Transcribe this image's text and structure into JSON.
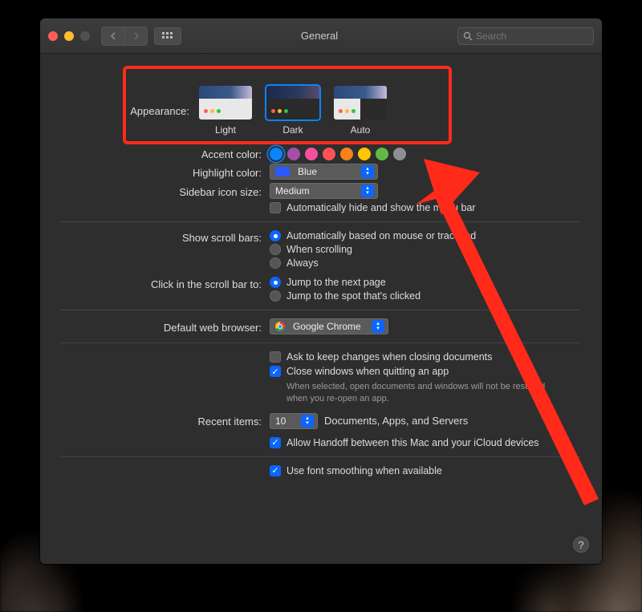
{
  "window": {
    "title": "General",
    "search_placeholder": "Search"
  },
  "appearance": {
    "label": "Appearance:",
    "options": [
      "Light",
      "Dark",
      "Auto"
    ],
    "selected": "Dark"
  },
  "accent": {
    "label": "Accent color:",
    "colors": [
      "#0a84ff",
      "#a550a7",
      "#f74f9e",
      "#ff5257",
      "#f7821b",
      "#ffc600",
      "#62ba46",
      "#8e8e93"
    ],
    "selected_index": 0
  },
  "highlight": {
    "label": "Highlight color:",
    "value": "Blue"
  },
  "sidebar_icon": {
    "label": "Sidebar icon size:",
    "value": "Medium"
  },
  "auto_hide_menu": {
    "label": "Automatically hide and show the menu bar",
    "checked": false
  },
  "scroll_bars": {
    "label": "Show scroll bars:",
    "options": [
      "Automatically based on mouse or trackpad",
      "When scrolling",
      "Always"
    ],
    "selected_index": 0
  },
  "click_scroll": {
    "label": "Click in the scroll bar to:",
    "options": [
      "Jump to the next page",
      "Jump to the spot that's clicked"
    ],
    "selected_index": 0
  },
  "default_browser": {
    "label": "Default web browser:",
    "value": "Google Chrome"
  },
  "ask_keep_changes": {
    "label": "Ask to keep changes when closing documents",
    "checked": false
  },
  "close_windows": {
    "label": "Close windows when quitting an app",
    "checked": true,
    "hint": "When selected, open documents and windows will not be restored when you re-open an app."
  },
  "recent_items": {
    "label": "Recent items:",
    "value": "10",
    "suffix": "Documents, Apps, and Servers"
  },
  "handoff": {
    "label": "Allow Handoff between this Mac and your iCloud devices",
    "checked": true
  },
  "font_smoothing": {
    "label": "Use font smoothing when available",
    "checked": true
  },
  "help_tooltip": "?"
}
